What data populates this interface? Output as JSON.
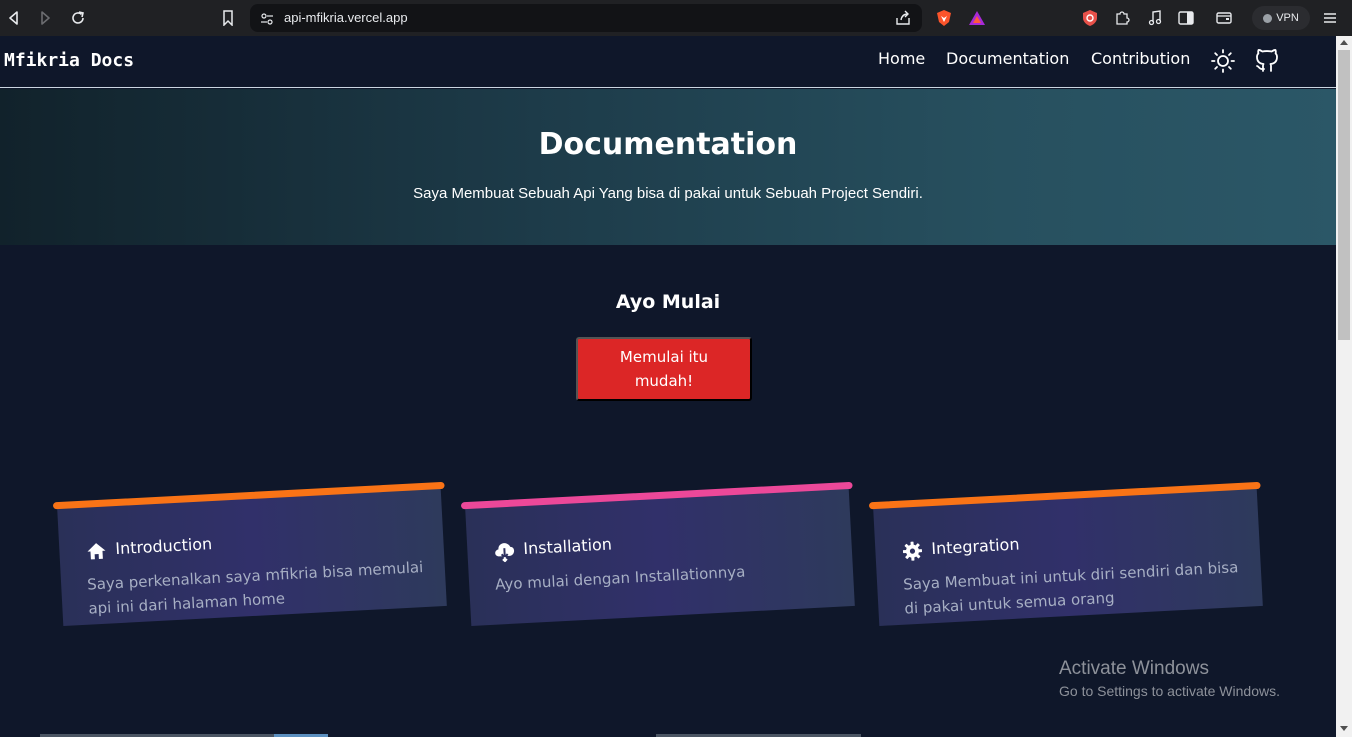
{
  "browser": {
    "url": "api-mfikria.vercel.app",
    "vpn_label": "VPN"
  },
  "nav": {
    "brand": "Mfikria Docs",
    "links": [
      "Home",
      "Documentation",
      "Contribution"
    ]
  },
  "hero": {
    "title": "Documentation",
    "subtitle": "Saya Membuat Sebuah Api Yang bisa di pakai untuk Sebuah Project Sendiri."
  },
  "start": {
    "title": "Ayo Mulai",
    "button_label": "Memulai itu mudah!"
  },
  "cards": [
    {
      "title": "Introduction",
      "description": "Saya perkenalkan saya mfikria bisa memulai api ini dari halaman home",
      "accent": "#f97316",
      "icon": "home-icon"
    },
    {
      "title": "Installation",
      "description": "Ayo mulai dengan Installationnya",
      "accent": "#ec4899",
      "icon": "cloud-download-icon"
    },
    {
      "title": "Integration",
      "description": "Saya Membuat ini untuk diri sendiri dan bisa di pakai untuk semua orang",
      "accent": "#f97316",
      "icon": "gear-icon"
    }
  ],
  "watermark": {
    "title": "Activate Windows",
    "subtitle": "Go to Settings to activate Windows."
  },
  "colors": {
    "page_bg": "#0f172a",
    "button_red": "#dc2626",
    "card_bg": "#2e3160"
  }
}
